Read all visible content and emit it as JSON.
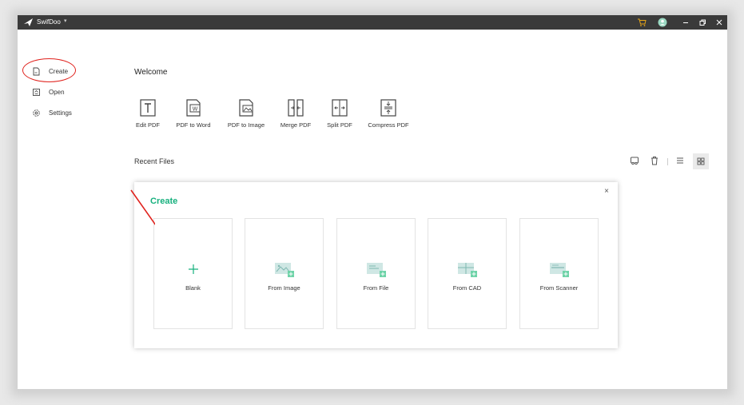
{
  "app": {
    "name": "SwifDoo"
  },
  "sidebar": {
    "items": [
      {
        "label": "Create",
        "icon": "create-doc-icon"
      },
      {
        "label": "Open",
        "icon": "folder-open-icon"
      },
      {
        "label": "Settings",
        "icon": "gear-icon"
      }
    ]
  },
  "main": {
    "welcome": "Welcome",
    "tools": [
      {
        "label": "Edit PDF",
        "icon": "edit-pdf-icon"
      },
      {
        "label": "PDF to Word",
        "icon": "pdf-to-word-icon"
      },
      {
        "label": "PDF to Image",
        "icon": "pdf-to-image-icon"
      },
      {
        "label": "Merge PDF",
        "icon": "merge-pdf-icon"
      },
      {
        "label": "Split PDF",
        "icon": "split-pdf-icon"
      },
      {
        "label": "Compress PDF",
        "icon": "compress-pdf-icon"
      }
    ],
    "recent_files": "Recent Files"
  },
  "dialog": {
    "title": "Create",
    "close": "×",
    "options": [
      {
        "label": "Blank",
        "icon": "plus-icon"
      },
      {
        "label": "From Image",
        "icon": "image-add-icon"
      },
      {
        "label": "From File",
        "icon": "file-add-icon"
      },
      {
        "label": "From CAD",
        "icon": "cad-add-icon"
      },
      {
        "label": "From Scanner",
        "icon": "scanner-add-icon"
      }
    ]
  },
  "colors": {
    "accent": "#16b07d",
    "titlebar": "#3a3a3a",
    "annotation": "#e0221d"
  }
}
